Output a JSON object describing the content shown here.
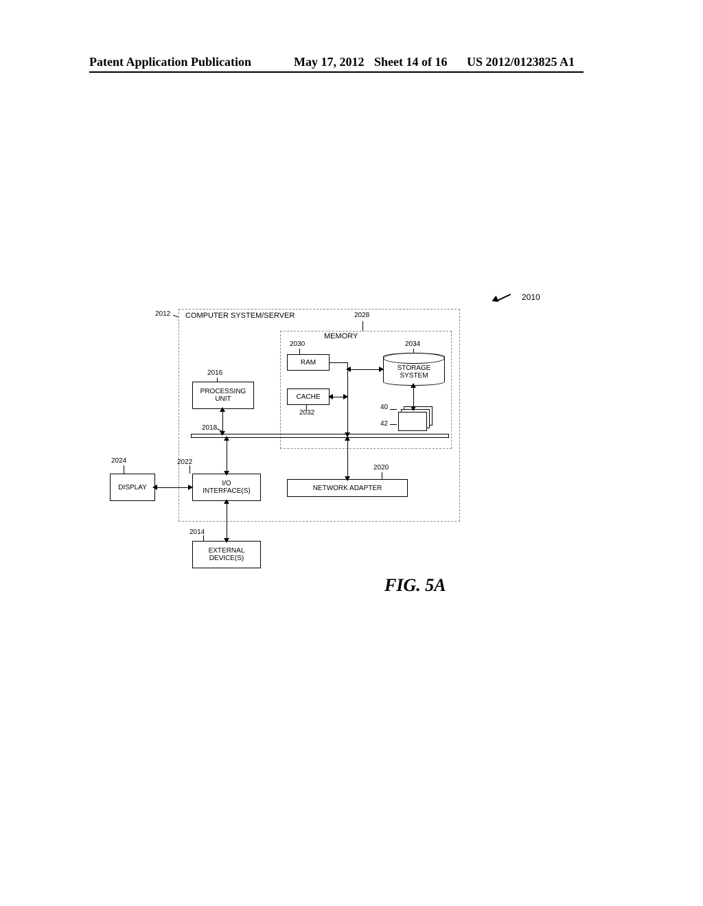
{
  "header": {
    "left": "Patent Application Publication",
    "mid_date": "May 17, 2012",
    "mid_sheet": "Sheet 14 of 16",
    "right": "US 2012/0123825 A1"
  },
  "refs": {
    "outer_system": "2010",
    "computer_system": "2012",
    "external_devices": "2014",
    "processing_unit": "2016",
    "bus": "2018",
    "network_adapter": "2020",
    "io_interfaces": "2022",
    "display": "2024",
    "memory": "2028",
    "ram": "2030",
    "cache": "2032",
    "storage_system": "2034",
    "stack_a": "40",
    "stack_b": "42"
  },
  "labels": {
    "computer_system": "COMPUTER SYSTEM/SERVER",
    "memory": "MEMORY",
    "ram": "RAM",
    "cache": "CACHE",
    "processing_unit": "PROCESSING\nUNIT",
    "storage_system": "STORAGE\nSYSTEM",
    "io": "I/O\nINTERFACE(S)",
    "network_adapter": "NETWORK ADAPTER",
    "display": "DISPLAY",
    "external": "EXTERNAL\nDEVICE(S)"
  },
  "figure_caption": "FIG. 5A"
}
